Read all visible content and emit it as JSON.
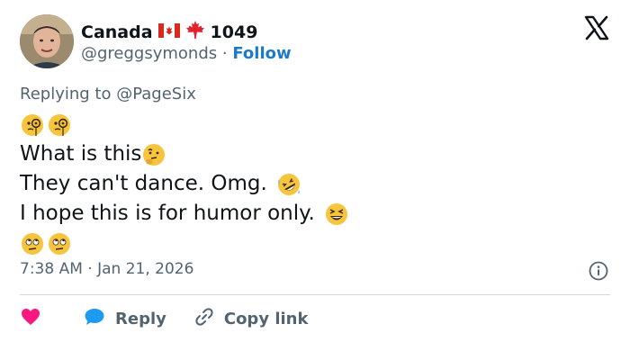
{
  "tweet": {
    "author": {
      "display_name": "Canada",
      "number_suffix": "1049",
      "handle": "@greggsymonds",
      "separator": "·",
      "follow_label": "Follow"
    },
    "replying_prefix": "Replying to",
    "replying_handle": "@PageSix",
    "lines": {
      "line2": "What is this",
      "line3": "They can't dance.  Omg.",
      "line4": "I hope this is for humor only."
    },
    "timestamp": "7:38 AM · Jan 21, 2026",
    "actions": {
      "reply_label": "Reply",
      "copy_link_label": "Copy link"
    }
  },
  "colors": {
    "accent": "#1d7acb",
    "secondary_text": "#536471",
    "like": "#f91880",
    "reply": "#1d9bf0"
  },
  "icons": [
    "x-logo-icon",
    "canada-flag-icon",
    "maple-leaf-icon",
    "monocle-face-emoji",
    "thinking-face-emoji",
    "rolling-laughing-emoji",
    "grinning-squinting-emoji",
    "eye-roll-emoji",
    "info-icon",
    "heart-icon",
    "reply-bubble-icon",
    "link-icon"
  ]
}
